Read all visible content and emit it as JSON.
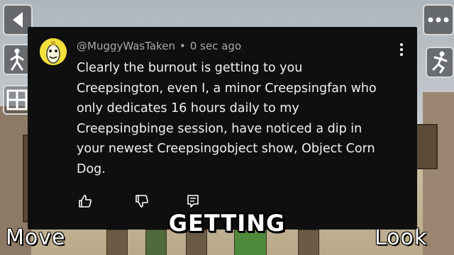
{
  "comment": {
    "handle": "@MuggyWasTaken",
    "separator": "•",
    "time": "0 sec ago",
    "lines": [
      "Clearly the burnout is getting to you",
      "Creepsington, even I, a minor Creepsingfan who",
      "only dedicates 16 hours daily to my",
      "Creepsingbinge session, have noticed a dip in",
      "your newest Creepsingobject show, Object Corn",
      "Dog."
    ],
    "icons": {
      "more": "more-vertical-icon",
      "like": "thumbs-up-icon",
      "dislike": "thumbs-down-icon",
      "reply": "reply-comment-icon"
    }
  },
  "hud": {
    "move_label": "Move",
    "look_label": "Look",
    "icons": {
      "back": "back-arrow-icon",
      "menu": "more-horizontal-icon",
      "walk": "walking-person-icon",
      "inventory": "grid-icon",
      "jump": "jumping-person-icon"
    }
  },
  "caption": {
    "text": "GETTING"
  },
  "colors": {
    "comment_bg": "#0f0f0f",
    "comment_text": "#f1f1f1",
    "meta_text": "#aaaaaa",
    "avatar_bg": "#f2e13a"
  }
}
